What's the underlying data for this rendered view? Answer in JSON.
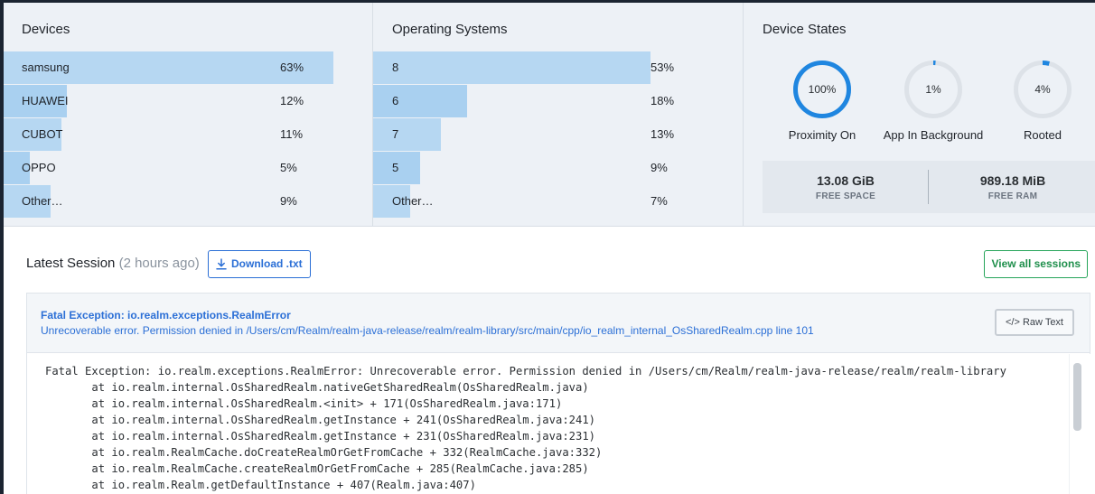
{
  "devices": {
    "title": "Devices",
    "rows": [
      {
        "label": "samsung",
        "pct_text": "63%",
        "fraction": 0.63,
        "color": "#b6d7f2"
      },
      {
        "label": "HUAWEI",
        "pct_text": "12%",
        "fraction": 0.12,
        "color": "#a9d0f0"
      },
      {
        "label": "CUBOT",
        "pct_text": "11%",
        "fraction": 0.11,
        "color": "#b6d7f2"
      },
      {
        "label": "OPPO",
        "pct_text": "5%",
        "fraction": 0.05,
        "color": "#a9d0f0"
      },
      {
        "label": "Other…",
        "pct_text": "9%",
        "fraction": 0.09,
        "color": "#b6d7f2"
      }
    ]
  },
  "operating_systems": {
    "title": "Operating Systems",
    "rows": [
      {
        "label": "8",
        "pct_text": "53%",
        "fraction": 0.53,
        "color": "#b6d7f2"
      },
      {
        "label": "6",
        "pct_text": "18%",
        "fraction": 0.18,
        "color": "#a9d0f0"
      },
      {
        "label": "7",
        "pct_text": "13%",
        "fraction": 0.13,
        "color": "#b6d7f2"
      },
      {
        "label": "5",
        "pct_text": "9%",
        "fraction": 0.09,
        "color": "#a9d0f0"
      },
      {
        "label": "Other…",
        "pct_text": "7%",
        "fraction": 0.07,
        "color": "#b6d7f2"
      }
    ]
  },
  "device_states": {
    "title": "Device States",
    "rings": [
      {
        "value_text": "100%",
        "fraction": 1.0,
        "label": "Proximity On"
      },
      {
        "value_text": "1%",
        "fraction": 0.01,
        "label": "App In Background"
      },
      {
        "value_text": "4%",
        "fraction": 0.04,
        "label": "Rooted"
      }
    ],
    "ring_color": "#1f86e0",
    "ring_track_color": "#dde2e8",
    "free_space": {
      "value": "13.08 GiB",
      "label": "FREE SPACE"
    },
    "free_ram": {
      "value": "989.18 MiB",
      "label": "FREE RAM"
    }
  },
  "session": {
    "title": "Latest Session",
    "ago": "(2 hours ago)",
    "download_label": "Download .txt",
    "view_all_label": "View all sessions"
  },
  "exception": {
    "title": "Fatal Exception: io.realm.exceptions.RealmError",
    "subtitle": "Unrecoverable error. Permission denied in /Users/cm/Realm/realm-java-release/realm/realm-library/src/main/cpp/io_realm_internal_OsSharedRealm.cpp line 101",
    "raw_text_label": "Raw Text",
    "trace_lines": [
      "Fatal Exception: io.realm.exceptions.RealmError: Unrecoverable error. Permission denied in /Users/cm/Realm/realm-java-release/realm/realm-library",
      "       at io.realm.internal.OsSharedRealm.nativeGetSharedRealm(OsSharedRealm.java)",
      "       at io.realm.internal.OsSharedRealm.<init> + 171(OsSharedRealm.java:171)",
      "       at io.realm.internal.OsSharedRealm.getInstance + 241(OsSharedRealm.java:241)",
      "       at io.realm.internal.OsSharedRealm.getInstance + 231(OsSharedRealm.java:231)",
      "       at io.realm.RealmCache.doCreateRealmOrGetFromCache + 332(RealmCache.java:332)",
      "       at io.realm.RealmCache.createRealmOrGetFromCache + 285(RealmCache.java:285)",
      "       at io.realm.Realm.getDefaultInstance + 407(Realm.java:407)"
    ]
  }
}
